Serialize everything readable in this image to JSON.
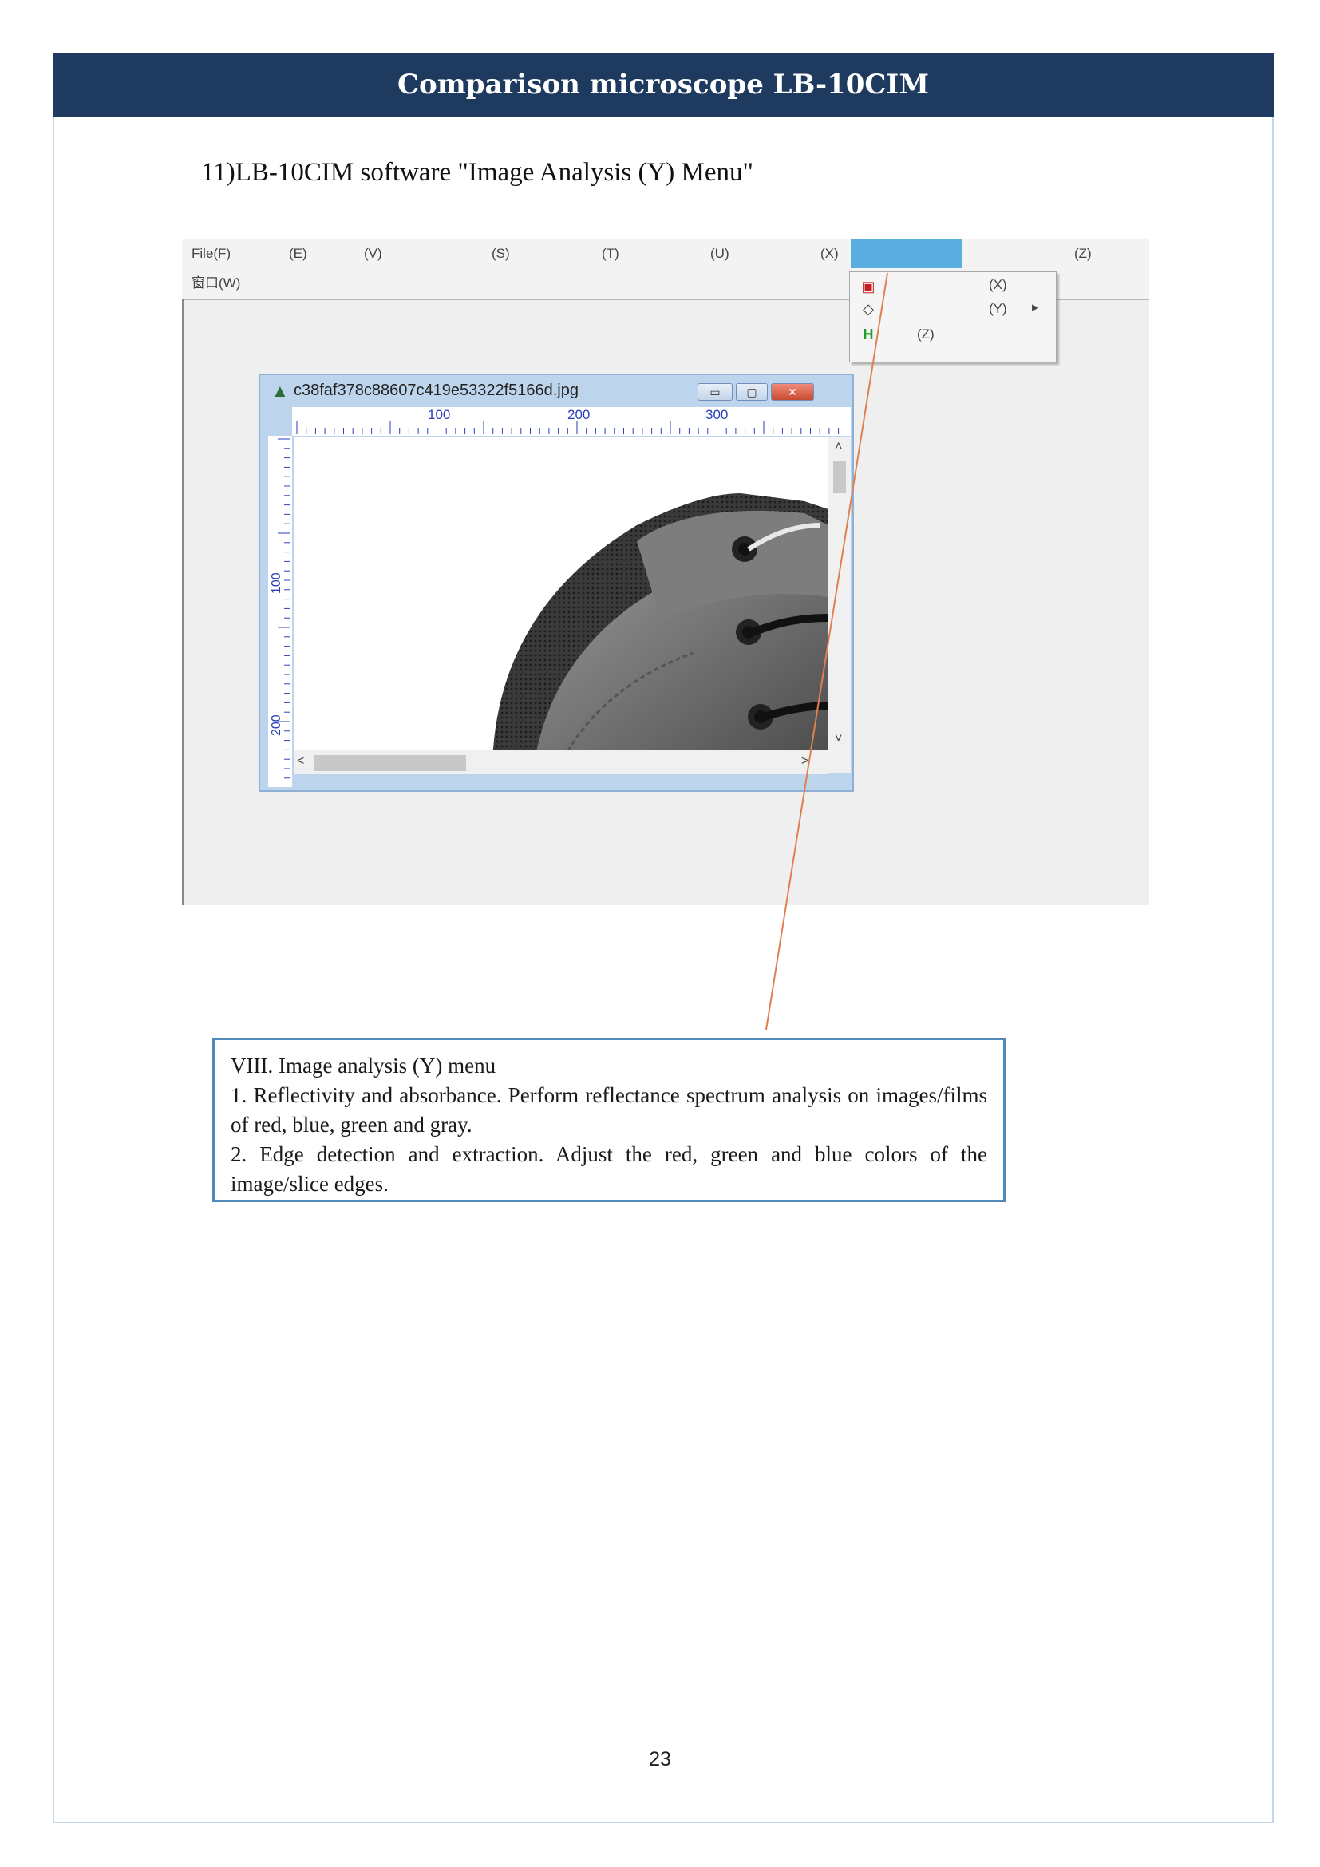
{
  "header": {
    "title": "Comparison microscope LB-10CIM"
  },
  "section": {
    "title": "11)LB-10CIM software \"Image Analysis (Y) Menu\""
  },
  "app": {
    "menu": {
      "file": "File(F)",
      "e": "(E)",
      "v": "(V)",
      "s": "(S)",
      "t": "(T)",
      "u": "(U)",
      "x": "(X)",
      "z": "(Z)",
      "window": "窗口(W)"
    },
    "dropdown": {
      "item_x": "(X)",
      "item_y": "(Y)",
      "item_z": "(Z)",
      "submenu_arrow": "▸"
    },
    "image_window": {
      "title": "c38faf378c88607c419e53322f5166d.jpg",
      "ruler_top": [
        "100",
        "200",
        "300"
      ],
      "ruler_left": [
        "100",
        "200"
      ],
      "min_label": "▭",
      "max_label": "▢",
      "close_label": "✕"
    }
  },
  "caption": {
    "heading": "VIII. Image analysis (Y) menu",
    "line1": "1. Reflectivity and absorbance. Perform reflectance spectrum analysis on images/films of red, blue, green and gray.",
    "line2": "2. Edge detection and extraction. Adjust the red, green and blue colors of the image/slice edges."
  },
  "page": {
    "number": "23"
  },
  "colors": {
    "header_bg": "#1e3a5f",
    "menu_highlight": "#5aaee0",
    "connector": "#e08050",
    "caption_border": "#5389b9"
  }
}
